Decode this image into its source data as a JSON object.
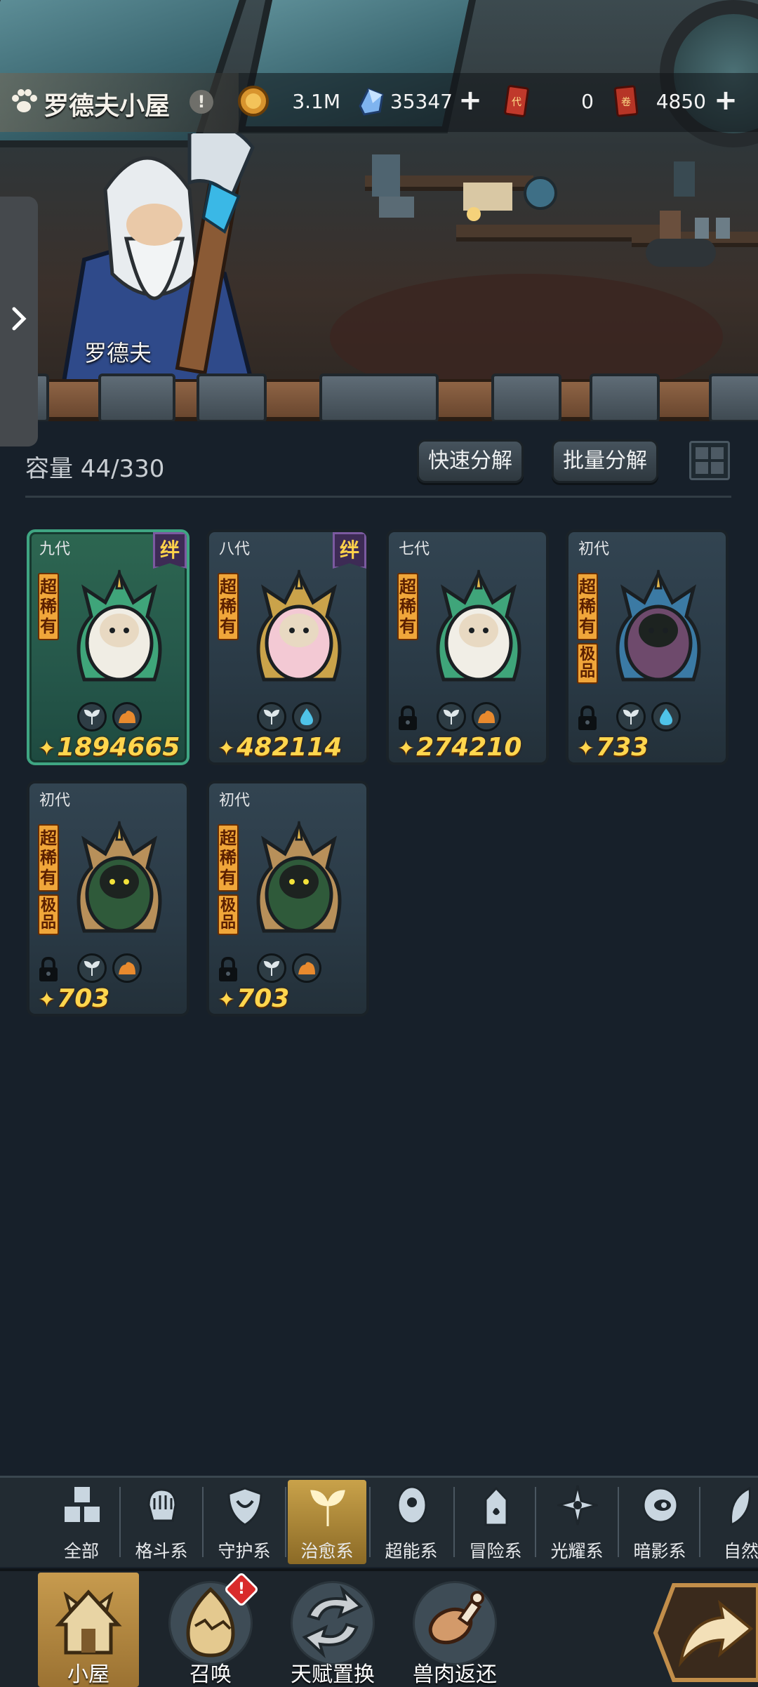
{
  "header": {
    "shop_title": "罗德夫小屋",
    "npc_name": "罗德夫",
    "currencies": [
      {
        "name": "gold-coin-icon",
        "value": "3.1M"
      },
      {
        "name": "crystal-icon",
        "value": "35347"
      },
      {
        "name": "ticket-icon",
        "value": "0"
      },
      {
        "name": "scroll-icon",
        "value": "4850"
      }
    ]
  },
  "storage": {
    "capacity_label": "容量 44/330",
    "quick_decompose": "快速分解",
    "batch_decompose": "批量分解"
  },
  "cards": [
    {
      "gen": "九代",
      "rarity": "超稀有",
      "bond": "绊",
      "power": "1894665",
      "elements": [
        "heal",
        "earth"
      ],
      "locked": false,
      "selected": true
    },
    {
      "gen": "八代",
      "rarity": "超稀有",
      "bond": "绊",
      "power": "482114",
      "elements": [
        "heal",
        "water"
      ],
      "locked": false
    },
    {
      "gen": "七代",
      "rarity": "超稀有",
      "power": "274210",
      "elements": [
        "heal",
        "earth"
      ],
      "locked": true
    },
    {
      "gen": "初代",
      "rarity": "超稀有",
      "tier": "极品",
      "power": "733",
      "elements": [
        "heal",
        "water"
      ],
      "locked": true
    },
    {
      "gen": "初代",
      "rarity": "超稀有",
      "tier": "极品",
      "power": "703",
      "elements": [
        "heal",
        "earth"
      ],
      "locked": true
    },
    {
      "gen": "初代",
      "rarity": "超稀有",
      "tier": "极品",
      "power": "703",
      "elements": [
        "heal",
        "earth"
      ],
      "locked": true
    }
  ],
  "filters": [
    "全部",
    "格斗系",
    "守护系",
    "治愈系",
    "超能系",
    "冒险系",
    "光耀系",
    "暗影系",
    "自然"
  ],
  "active_filter": "治愈系",
  "nav": [
    "小屋",
    "召唤",
    "天赋置换",
    "兽肉返还"
  ],
  "summon_badge": "!",
  "colors": {
    "accent_gold": "#ffd64e",
    "selected_card": "#3fa582",
    "bond_purple": "#3d2b55"
  }
}
